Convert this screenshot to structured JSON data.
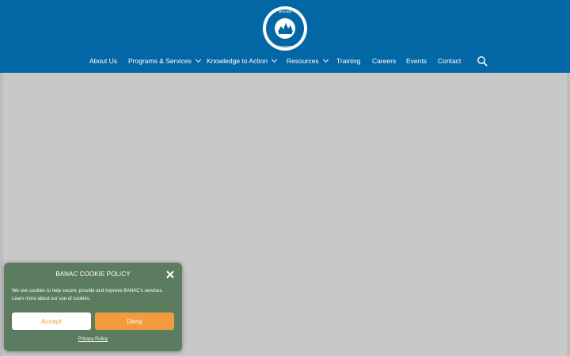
{
  "header": {
    "logo": {
      "top_text": "Mamawi",
      "arc_text": "Toronto Area Native Canadian",
      "bottom_text": "Wiijiseeddadmin"
    },
    "nav": {
      "items": [
        {
          "label": "About Us",
          "has_dropdown": false
        },
        {
          "label": "Programs & Services",
          "has_dropdown": true
        },
        {
          "label": "Knowledge to Action",
          "has_dropdown": true
        },
        {
          "label": "Resources",
          "has_dropdown": true
        },
        {
          "label": "Training",
          "has_dropdown": false
        },
        {
          "label": "Careers",
          "has_dropdown": false
        },
        {
          "label": "Events",
          "has_dropdown": false
        },
        {
          "label": "Contact",
          "has_dropdown": false
        }
      ],
      "search_icon": "search-icon"
    }
  },
  "cookie_banner": {
    "title": "BANAC COOKIE POLICY",
    "body": "We use cookies to help secure, provide and improve BANAC's services. Learn more about our use of cookies.",
    "accept_label": "Accept",
    "deny_label": "Deny",
    "privacy_link": "Privacy Policy",
    "close_icon": "close-icon"
  },
  "colors": {
    "header_bg": "#0367a6",
    "content_bg": "#c8c8c8",
    "banner_bg": "#5c7c5f",
    "accent_orange": "#f39a3f"
  }
}
